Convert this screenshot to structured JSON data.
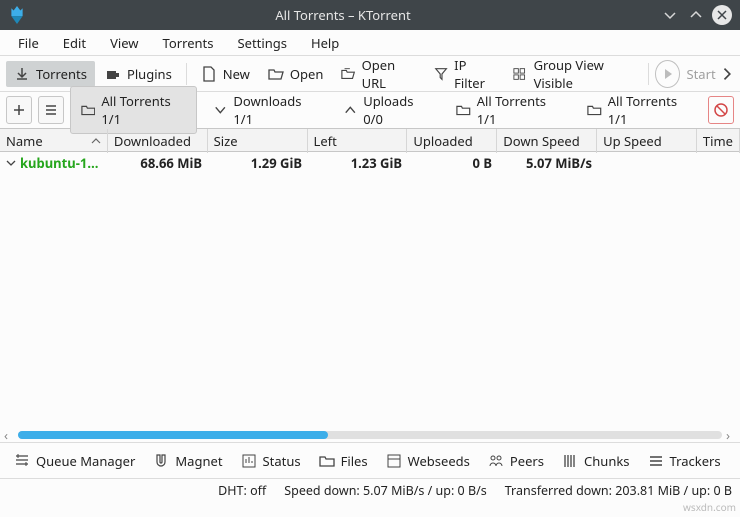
{
  "window": {
    "title": "All Torrents – KTorrent"
  },
  "menu": {
    "file": "File",
    "edit": "Edit",
    "view": "View",
    "torrents": "Torrents",
    "settings": "Settings",
    "help": "Help"
  },
  "toolbar": {
    "torrents": "Torrents",
    "plugins": "Plugins",
    "new": "New",
    "open": "Open",
    "open_url": "Open URL",
    "ip_filter": "IP Filter",
    "group_view": "Group View Visible",
    "start": "Start"
  },
  "tabs": {
    "all": "All Torrents 1/1",
    "downloads": "Downloads 1/1",
    "uploads": "Uploads 0/0",
    "all2": "All Torrents 1/1",
    "all3": "All Torrents 1/1"
  },
  "columns": {
    "name": "Name",
    "downloaded": "Downloaded",
    "size": "Size",
    "left": "Left",
    "uploaded": "Uploaded",
    "down_speed": "Down Speed",
    "up_speed": "Up Speed",
    "time": "Time"
  },
  "rows": [
    {
      "name": "kubuntu-1…",
      "downloaded": "68.66 MiB",
      "size": "1.29 GiB",
      "left": "1.23 GiB",
      "uploaded": "0 B",
      "down_speed": "5.07 MiB/s",
      "up_speed": ""
    }
  ],
  "bottom": {
    "queue": "Queue Manager",
    "magnet": "Magnet",
    "status": "Status",
    "files": "Files",
    "webseeds": "Webseeds",
    "peers": "Peers",
    "chunks": "Chunks",
    "trackers": "Trackers"
  },
  "status": {
    "dht": "DHT: off",
    "speed": "Speed down: 5.07 MiB/s / up: 0 B/s",
    "transferred": "Transferred down: 203.81 MiB / up: 0 B"
  },
  "watermark": "wsxdn.com"
}
